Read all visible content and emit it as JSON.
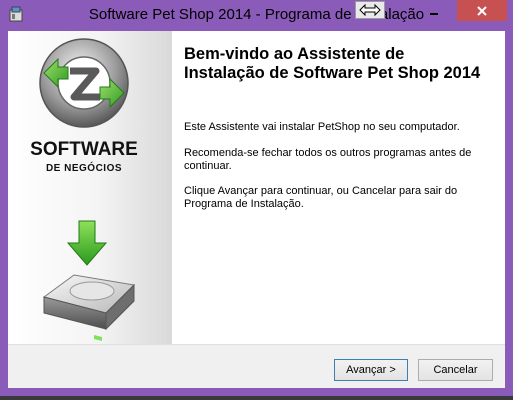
{
  "window": {
    "title": "Software Pet Shop 2014 - Programa de Instalação"
  },
  "sidebar": {
    "brand_title": "SOFTWARE",
    "brand_subtitle": "DE NEGÓCIOS"
  },
  "main": {
    "heading": "Bem-vindo ao Assistente de Instalação de Software Pet Shop 2014",
    "paragraphs": [
      "Este Assistente vai instalar PetShop no seu computador.",
      "Recomenda-se fechar todos os outros programas antes de continuar.",
      "Clique Avançar para continuar, ou Cancelar para sair do Programa de Instalação."
    ]
  },
  "footer": {
    "next_label": "Avançar >",
    "cancel_label": "Cancelar"
  },
  "icons": {
    "app": "installer-icon",
    "logo": "recycle-arrows-icon",
    "drive": "hard-drive-download-icon"
  },
  "colors": {
    "window_frame": "#8a5bb8",
    "close_button": "#c75050",
    "arrow_green": "#3aa830"
  }
}
